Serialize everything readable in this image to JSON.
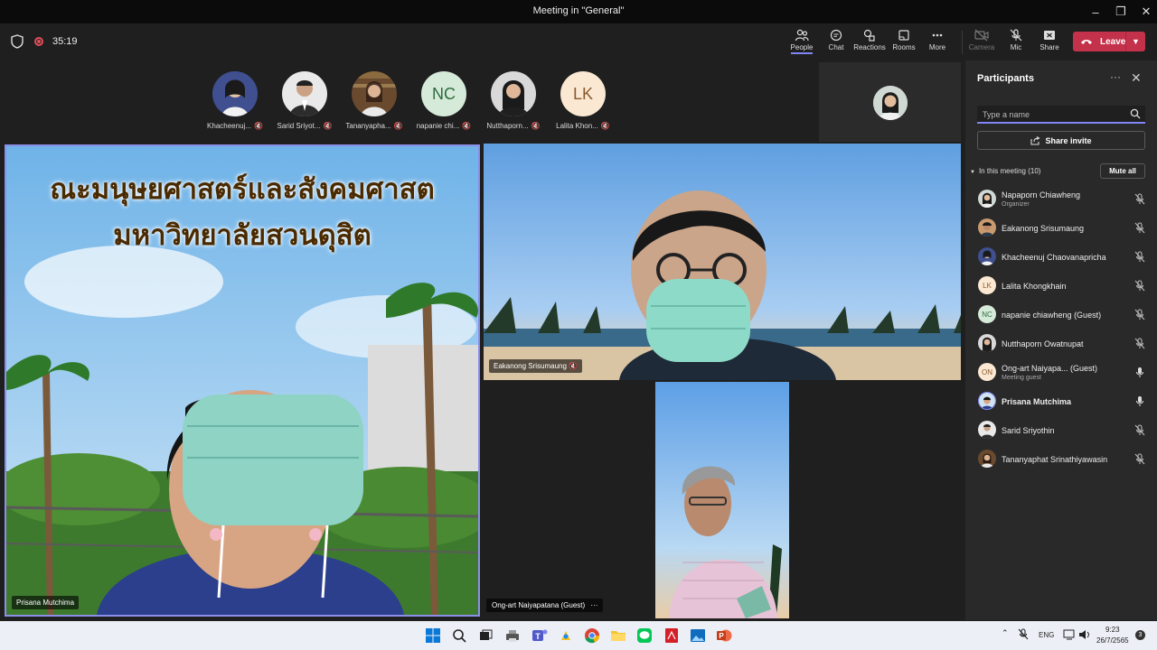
{
  "window": {
    "title": "Meeting in \"General\""
  },
  "meeting": {
    "timer": "35:19"
  },
  "toolbar": {
    "people": "People",
    "chat": "Chat",
    "reactions": "Reactions",
    "rooms": "Rooms",
    "more": "More",
    "camera": "Camera",
    "mic": "Mic",
    "share": "Share",
    "leave": "Leave"
  },
  "stage_avatars": [
    {
      "name": "Khacheenuj...",
      "initials": ""
    },
    {
      "name": "Sarid Sriyot...",
      "initials": ""
    },
    {
      "name": "Tananyapha...",
      "initials": ""
    },
    {
      "name": "napanie chi...",
      "initials": "NC"
    },
    {
      "name": "Nutthaporn...",
      "initials": ""
    },
    {
      "name": "Lalita Khon...",
      "initials": "LK"
    }
  ],
  "tiles": {
    "main_banner_line1": "ณะมนุษยศาสตร์และสังคมศาสต",
    "main_banner_line2": "มหาวิทยาลัยสวนดุสิต",
    "main_label": "Prisana Mutchima",
    "second_label": "Eakanong Srisumaung",
    "third_label": "Ong-art Naiyapatana (Guest)",
    "third_more": "···"
  },
  "panel": {
    "title": "Participants",
    "more": "···",
    "search_placeholder": "Type a name",
    "share_invite": "Share invite",
    "section": "In this meeting (10)",
    "mute_all": "Mute all",
    "participants": [
      {
        "name": "Napaporn Chiawheng",
        "sub": "Organizer",
        "initials": ""
      },
      {
        "name": "Eakanong Srisumaung",
        "sub": "",
        "initials": ""
      },
      {
        "name": "Khacheenuj Chaovanapricha",
        "sub": "",
        "initials": ""
      },
      {
        "name": "Lalita Khongkhain",
        "sub": "",
        "initials": "LK"
      },
      {
        "name": "napanie chiawheng (Guest)",
        "sub": "",
        "initials": "NC"
      },
      {
        "name": "Nutthaporn Owatnupat",
        "sub": "",
        "initials": ""
      },
      {
        "name": "Ong-art Naiyapa... (Guest)",
        "sub": "Meeting guest",
        "initials": "ON"
      },
      {
        "name": "Prisana Mutchima",
        "sub": "",
        "initials": ""
      },
      {
        "name": "Sarid Sriyothin",
        "sub": "",
        "initials": ""
      },
      {
        "name": "Tananyaphat Srinathiyawasin",
        "sub": "",
        "initials": ""
      }
    ]
  },
  "taskbar": {
    "lang": "ENG",
    "time": "9:23",
    "date": "26/7/2565",
    "notifications": "3"
  },
  "colors": {
    "accent": "#7f85f5",
    "leave": "#c4314b",
    "panel": "#292929",
    "stage": "#1f1f1f"
  }
}
